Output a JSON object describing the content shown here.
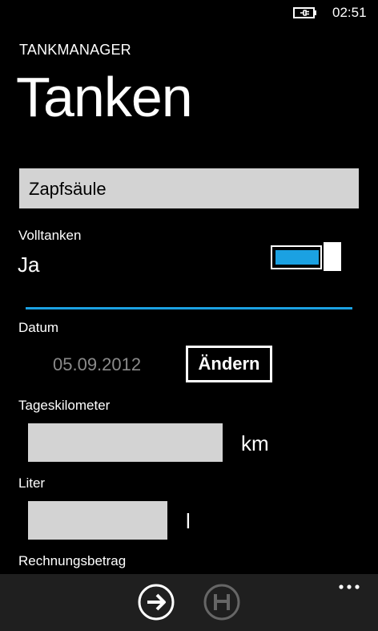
{
  "status": {
    "time": "02:51"
  },
  "header": {
    "app_title": "TANKMANAGER",
    "page_title": "Tanken"
  },
  "form": {
    "pump_select": {
      "value": "Zapfsäule"
    },
    "volltanken": {
      "label": "Volltanken",
      "value": "Ja",
      "toggle_on": true
    },
    "datum": {
      "label": "Datum",
      "value": "05.09.2012",
      "change_label": "Ändern"
    },
    "tageskilometer": {
      "label": "Tageskilometer",
      "value": "",
      "unit": "km"
    },
    "liter": {
      "label": "Liter",
      "value": "",
      "unit": "l"
    },
    "rechnungsbetrag": {
      "label": "Rechnungsbetrag"
    }
  },
  "app_bar": {
    "buttons": [
      {
        "icon": "arrow-right-circle-icon",
        "enabled": true
      },
      {
        "icon": "save-disk-icon",
        "enabled": false
      }
    ],
    "more": "..."
  },
  "colors": {
    "accent": "#1ba1e2",
    "background": "#000000",
    "field": "#d3d3d3",
    "app_bar": "#1f1f1f"
  }
}
